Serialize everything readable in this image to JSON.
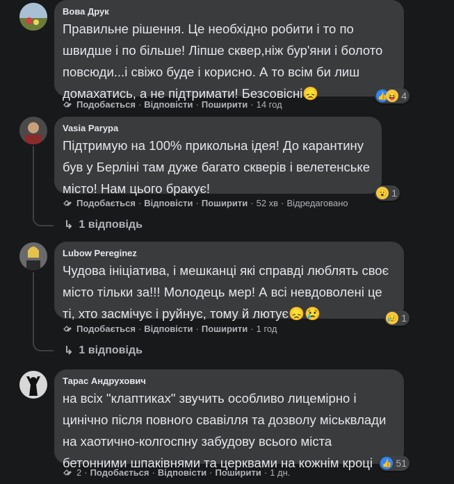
{
  "comments": [
    {
      "author": "Вова Друк",
      "text": "Правильне рішення. Це необхідно робити і то по\nшвидше і по більше! Ліпше сквер,ніж бур'яни і болото\nповсюди...і свіжо буде і корисно. А то всім би лиш\nдомахатись, а не підтримати! Безсовісні😞",
      "reactions": [
        "like-icon",
        "laugh-icon"
      ],
      "reaction_count": "4",
      "like": "Подобається",
      "reply": "Відповісти",
      "share": "Поширити",
      "time": "14 год"
    },
    {
      "author": "Vasia Parypa",
      "text": "Підтримую на 100% прикольна ідея! До карантину\nбув у Берліні там дуже багато скверів і велетенське\nмісто! Нам цього бракує!",
      "reactions": [
        "wow-icon"
      ],
      "reaction_count": "1",
      "like": "Подобається",
      "reply": "Відповісти",
      "share": "Поширити",
      "time": "52 хв",
      "edited": "Відредаговано",
      "replies": "1 відповідь"
    },
    {
      "author": "Lubow Pereginez",
      "text": "Чудова ініціатива, і мешканці які справді люблять своє\nмісто тільки за!!! Молодець мер! А всі невдоволені це\nті, хто засмічує і руйнує, тому й лютує😞😢",
      "reactions": [
        "sad-icon"
      ],
      "reaction_count": "1",
      "like": "Подобається",
      "reply": "Відповісти",
      "share": "Поширити",
      "time": "1 год",
      "replies": "1 відповідь"
    },
    {
      "author": "Тарас Андрухович",
      "text": "на всіх \"клаптиках\" звучить особливо лицемірно і\nцинічно після повного свавілля та дозволу міськвлади\nна хаотично-колгоспну забудову всього міста\nбетонними шпаківнями та церквами на кожнім кроці",
      "reactions": [
        "like-icon"
      ],
      "reaction_count": "51",
      "share_count": "2",
      "like": "Подобається",
      "reply": "Відповісти",
      "share": "Поширити",
      "time": "1 дн."
    }
  ],
  "colors": {
    "background": "#18191a",
    "bubble": "#3a3b3c",
    "text": "#e4e6eb",
    "secondary": "#b0b3b8",
    "like_blue": "#2d88ff"
  }
}
